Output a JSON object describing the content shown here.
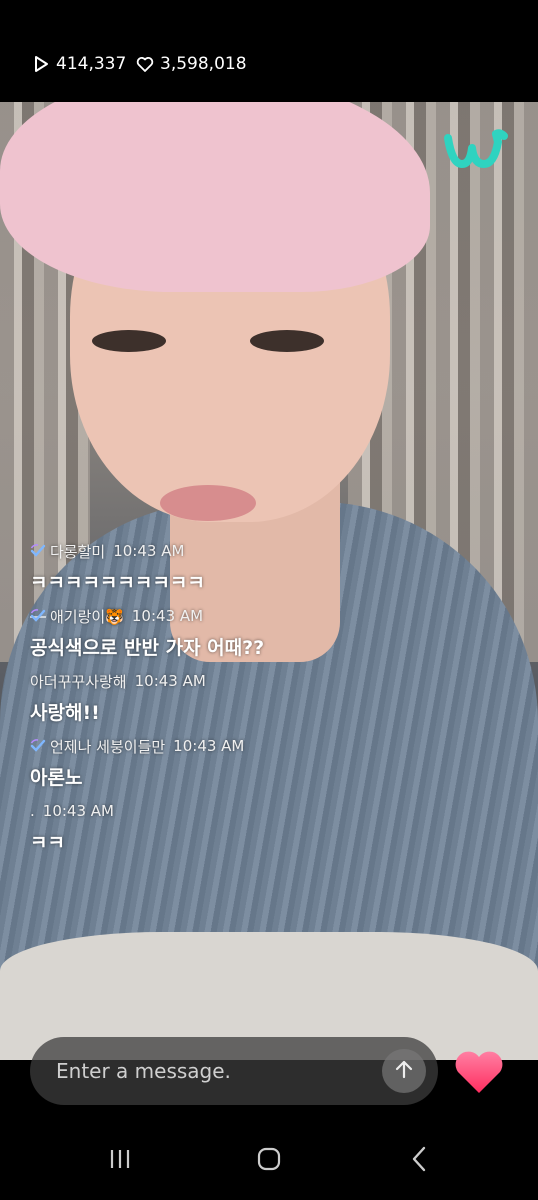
{
  "stats": {
    "views": "414,337",
    "likes": "3,598,018"
  },
  "logo": {
    "name": "weverse-logo",
    "color": "#2fd3c0"
  },
  "chat": [
    {
      "user": "다롱할미",
      "time": "10:43 AM",
      "text": "ㅋㅋㅋㅋㅋㅋㅋㅋㅋㅋ",
      "badge": true
    },
    {
      "user": "애기랑이🐯",
      "time": "10:43 AM",
      "text": "공식색으로 반반 가자 어때??",
      "badge": true
    },
    {
      "user": "아더꾸꾸사랑해",
      "time": "10:43 AM",
      "text": "사랑해!!",
      "badge": false
    },
    {
      "user": "언제나 세붕이들만",
      "time": "10:43 AM",
      "text": "아론노",
      "badge": true
    },
    {
      "user": ".",
      "time": "10:43 AM",
      "text": "ㅋㅋ",
      "badge": false
    }
  ],
  "input": {
    "placeholder": "Enter a message."
  },
  "colors": {
    "heart": "#ff3f73",
    "badge": "#7fb7ff"
  },
  "icons": {
    "views": "play-icon",
    "likes": "heart-outline-icon",
    "send": "arrow-up-icon",
    "heart_button": "heart-icon",
    "nav": [
      "recent-apps-icon",
      "home-icon",
      "back-icon"
    ]
  }
}
